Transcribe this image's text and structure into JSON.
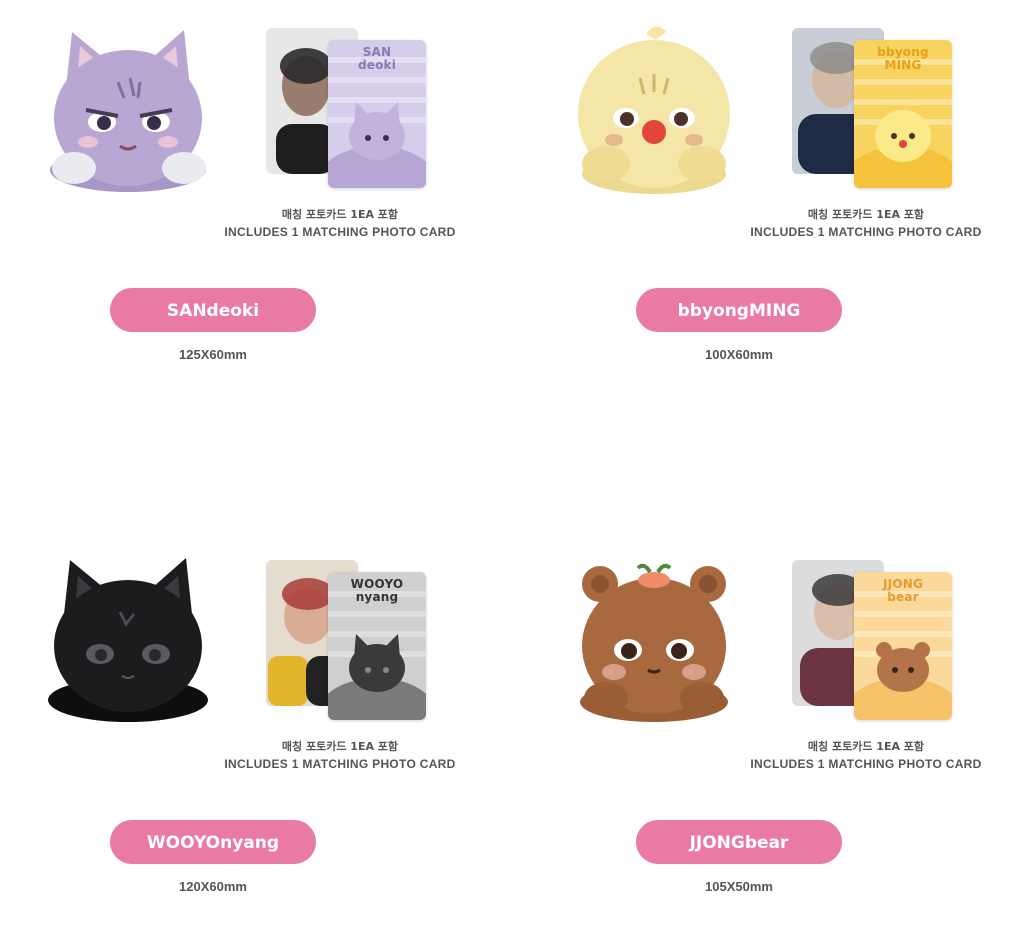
{
  "products": [
    {
      "name": "SANdeoki",
      "size": "125X60mm",
      "caption_ko": "매칭 포토카드 1EA 포함",
      "caption_en": "INCLUDES 1 MATCHING PHOTO CARD",
      "card_title": "SAN\ndeoki",
      "plush_icon": "purple-cat-plush",
      "colors": {
        "plush": "#b9a7d3",
        "plush_dark": "#8f7bb3",
        "card": "#d6cdea",
        "card_text": "#8a78b8"
      }
    },
    {
      "name": "bbyongMING",
      "size": "100X60mm",
      "caption_ko": "매칭 포토카드 1EA 포함",
      "caption_en": "INCLUDES 1 MATCHING PHOTO CARD",
      "card_title": "bbyong\nMING",
      "plush_icon": "yellow-chick-plush",
      "colors": {
        "plush": "#f3e6a6",
        "plush_dark": "#d9c676",
        "card": "#f7d45f",
        "card_text": "#e8a01a"
      }
    },
    {
      "name": "WOOYOnyang",
      "size": "120X60mm",
      "caption_ko": "매칭 포토카드 1EA 포함",
      "caption_en": "INCLUDES 1 MATCHING PHOTO CARD",
      "card_title": "WOOYO\nnyang",
      "plush_icon": "black-cat-plush",
      "colors": {
        "plush": "#1c1c1e",
        "plush_dark": "#000000",
        "card": "#cfcfcf",
        "card_text": "#333333"
      }
    },
    {
      "name": "JJONGbear",
      "size": "105X50mm",
      "caption_ko": "매칭 포토카드 1EA 포함",
      "caption_en": "INCLUDES 1 MATCHING PHOTO CARD",
      "card_title": "JJONG\nbear",
      "plush_icon": "brown-bear-plush",
      "colors": {
        "plush": "#a8693f",
        "plush_dark": "#7a4a2a",
        "card": "#fbd99a",
        "card_text": "#e69b2f"
      }
    }
  ],
  "button_color": "#e87aa4"
}
